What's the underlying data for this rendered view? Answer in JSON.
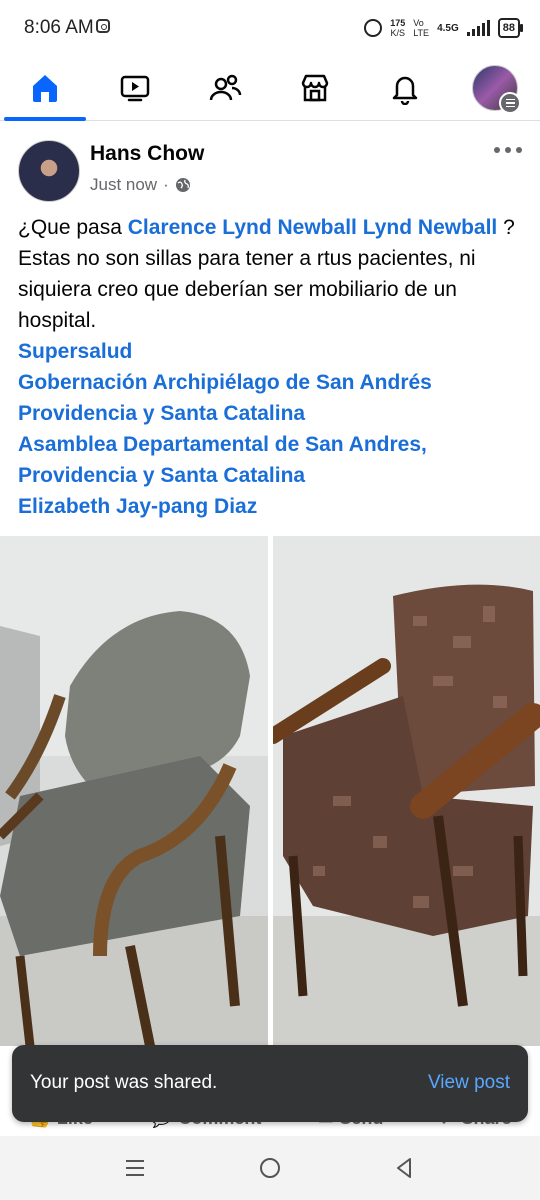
{
  "status_bar": {
    "time": "8:06 AM",
    "speed_value": "175",
    "speed_unit": "K/S",
    "volte_top": "Vo",
    "volte_bottom": "LTE",
    "network_top": "4.5G",
    "battery": "88"
  },
  "nav": {
    "items": [
      "home-icon",
      "video-icon",
      "friends-icon",
      "marketplace-icon",
      "notifications-icon",
      "profile-avatar"
    ],
    "active": "home",
    "accent": "#0866ff"
  },
  "post": {
    "author": "Hans Chow",
    "time": "Just now",
    "separator": "·",
    "text_prefix": "¿Que pasa ",
    "mention_1": "Clarence Lynd Newball Lynd Newball",
    "text_body": " ? Estas no son sillas para tener a rtus pacientes, ni siquiera creo que deberían ser mobiliario de un hospital.",
    "tags": [
      "Supersalud",
      "Gobernación Archipiélago de San Andrés Providencia y Santa Catalina",
      "Asamblea Departamental de San Andres, Providencia y Santa Catalina",
      "Elizabeth Jay-pang Diaz"
    ],
    "link_color": "#1a6ed8"
  },
  "actions": {
    "like": "Like",
    "comment": "Comment",
    "send": "Send",
    "share": "Share"
  },
  "snackbar": {
    "message": "Your post was shared.",
    "action": "View post"
  }
}
